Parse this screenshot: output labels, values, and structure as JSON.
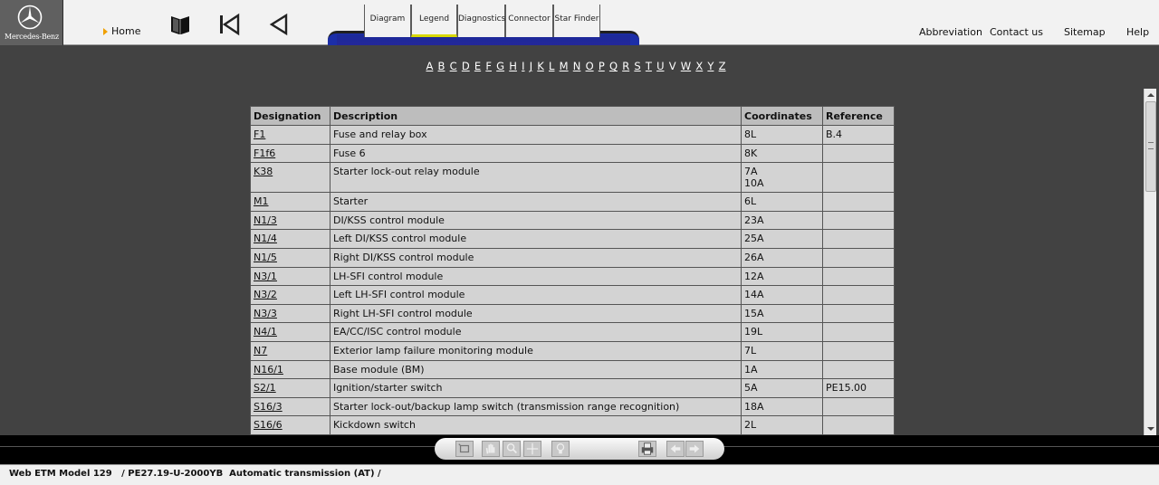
{
  "logo": {
    "brand": "Mercedes-Benz"
  },
  "nav": {
    "home": "Home",
    "tabs": [
      "Diagram",
      "Legend",
      "Diagnostics",
      "Connector",
      "Star Finder"
    ],
    "links": {
      "abbreviation": "Abbreviation",
      "contact": "Contact us",
      "sitemap": "Sitemap",
      "help": "Help"
    }
  },
  "alphabet": [
    "A",
    "B",
    "C",
    "D",
    "E",
    "F",
    "G",
    "H",
    "I",
    "J",
    "K",
    "L",
    "M",
    "N",
    "O",
    "P",
    "Q",
    "R",
    "S",
    "T",
    "U",
    "V",
    "W",
    "X",
    "Y",
    "Z"
  ],
  "table": {
    "headers": [
      "Designation",
      "Description",
      "Coordinates",
      "Reference"
    ],
    "rows": [
      [
        "F1",
        "Fuse and relay box",
        "8L",
        "B.4"
      ],
      [
        "F1f6",
        "Fuse 6",
        "8K",
        ""
      ],
      [
        "K38",
        "Starter lock-out relay module",
        "7A",
        ""
      ],
      [
        "",
        "",
        "10A",
        ""
      ],
      [
        "M1",
        "Starter",
        "6L",
        ""
      ],
      [
        "N1/3",
        "DI/KSS control module",
        "23A",
        ""
      ],
      [
        "N1/4",
        "Left DI/KSS control module",
        "25A",
        ""
      ],
      [
        "N1/5",
        "Right DI/KSS control module",
        "26A",
        ""
      ],
      [
        "N3/1",
        "LH-SFI control module",
        "12A",
        ""
      ],
      [
        "N3/2",
        "Left LH-SFI control module",
        "14A",
        ""
      ],
      [
        "N3/3",
        "Right LH-SFI control module",
        "15A",
        ""
      ],
      [
        "N4/1",
        "EA/CC/ISC control module",
        "19L",
        ""
      ],
      [
        "N7",
        "Exterior lamp failure monitoring module",
        "7L",
        ""
      ],
      [
        "N16/1",
        "Base module (BM)",
        "1A",
        ""
      ],
      [
        "S2/1",
        "Ignition/starter switch",
        "5A",
        "PE15.00"
      ],
      [
        "S16/3",
        "Starter lock-out/backup lamp switch (transmission range recognition)",
        "18A",
        ""
      ],
      [
        "S16/6",
        "Kickdown switch",
        "2L",
        ""
      ]
    ]
  },
  "status": {
    "text": "Web ETM Model 129   / PE27.19-U-2000YB  Automatic transmission (AT) /"
  },
  "colors": {
    "accent_tab": "#d8d800",
    "tabbar": "#1c2ea8",
    "background": "#424242"
  }
}
